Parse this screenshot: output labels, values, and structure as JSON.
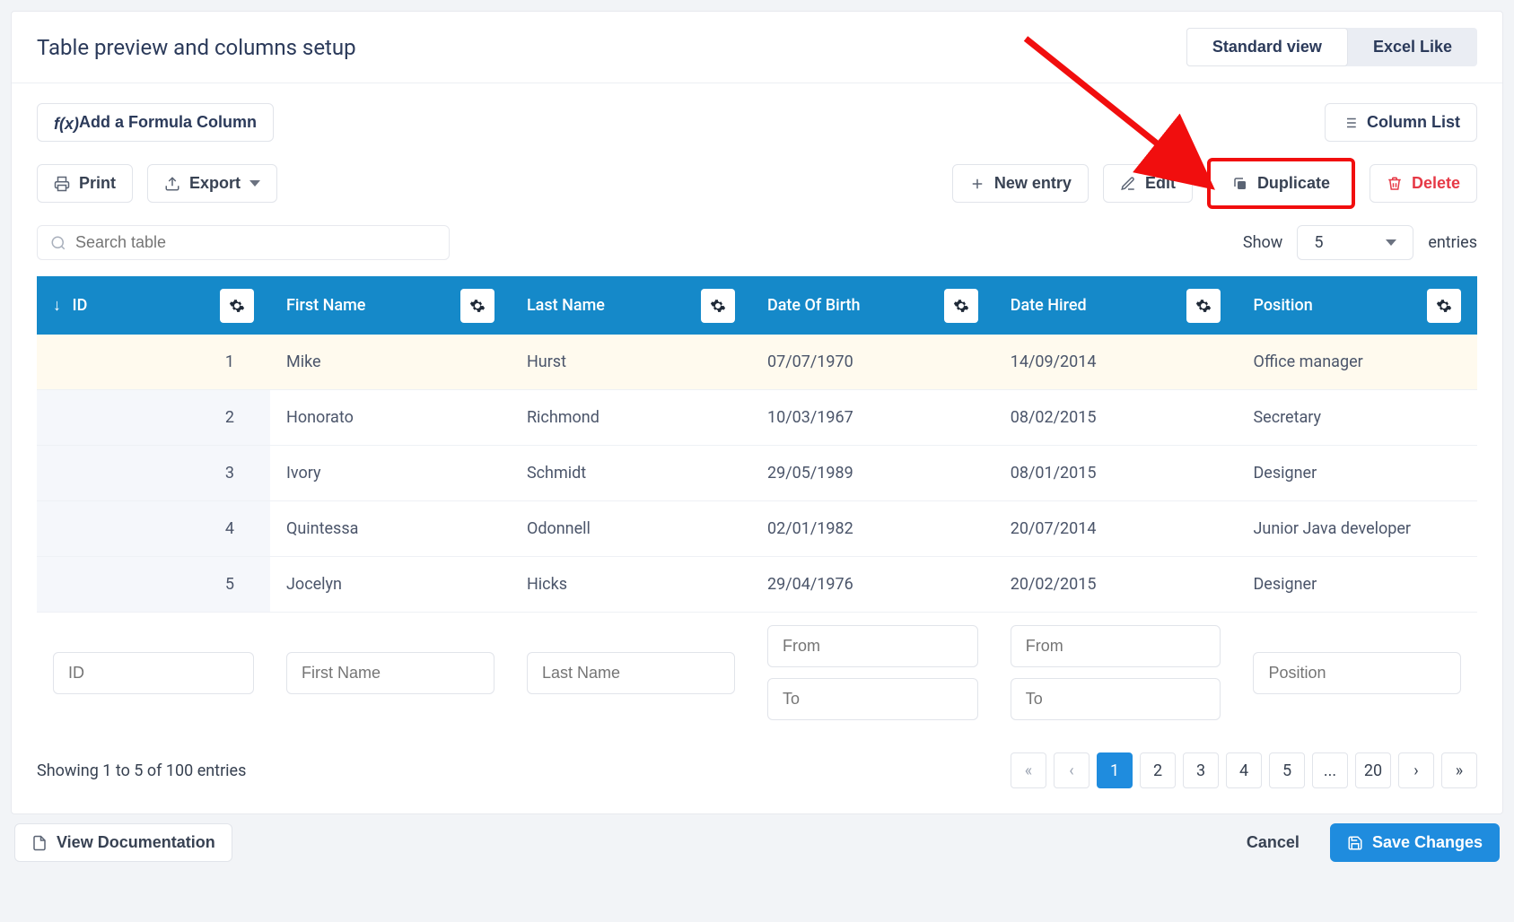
{
  "header": {
    "title": "Table preview and columns setup",
    "view_standard": "Standard view",
    "view_excel": "Excel Like"
  },
  "toolbar": {
    "formula_btn": "Add a Formula Column",
    "column_list_btn": "Column List",
    "print_btn": "Print",
    "export_btn": "Export",
    "new_entry_btn": "New entry",
    "edit_btn": "Edit",
    "duplicate_btn": "Duplicate",
    "delete_btn": "Delete",
    "search_placeholder": "Search table",
    "show_label": "Show",
    "show_value": "5",
    "entries_label": "entries"
  },
  "columns": [
    "ID",
    "First Name",
    "Last Name",
    "Date Of Birth",
    "Date Hired",
    "Position"
  ],
  "rows": [
    {
      "id": "1",
      "first": "Mike",
      "last": "Hurst",
      "dob": "07/07/1970",
      "hired": "14/09/2014",
      "position": "Office manager"
    },
    {
      "id": "2",
      "first": "Honorato",
      "last": "Richmond",
      "dob": "10/03/1967",
      "hired": "08/02/2015",
      "position": "Secretary"
    },
    {
      "id": "3",
      "first": "Ivory",
      "last": "Schmidt",
      "dob": "29/05/1989",
      "hired": "08/01/2015",
      "position": "Designer"
    },
    {
      "id": "4",
      "first": "Quintessa",
      "last": "Odonnell",
      "dob": "02/01/1982",
      "hired": "20/07/2014",
      "position": "Junior Java developer"
    },
    {
      "id": "5",
      "first": "Jocelyn",
      "last": "Hicks",
      "dob": "29/04/1976",
      "hired": "20/02/2015",
      "position": "Designer"
    }
  ],
  "filters": {
    "id": "ID",
    "first": "First Name",
    "last": "Last Name",
    "dob_from": "From",
    "dob_to": "To",
    "hired_from": "From",
    "hired_to": "To",
    "position": "Position"
  },
  "pagination": {
    "summary": "Showing 1 to 5 of 100 entries",
    "pages": [
      "1",
      "2",
      "3",
      "4",
      "5",
      "...",
      "20"
    ]
  },
  "footer": {
    "view_docs": "View Documentation",
    "cancel": "Cancel",
    "save": "Save Changes"
  }
}
